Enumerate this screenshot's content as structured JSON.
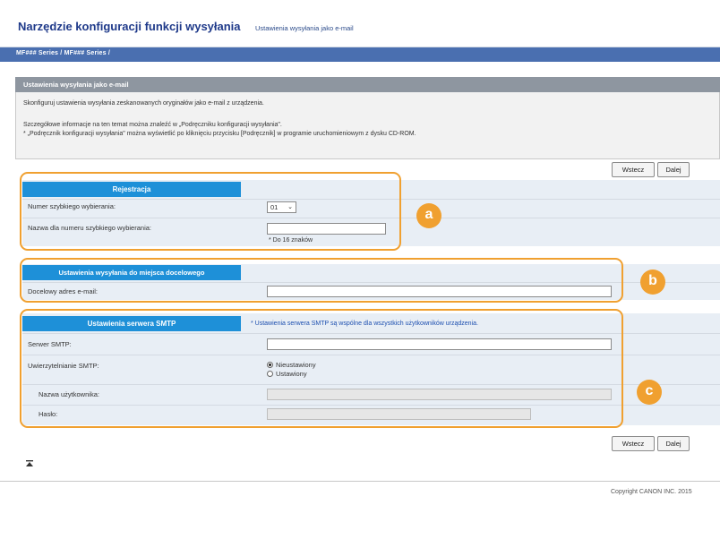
{
  "header": {
    "app_title": "Narzędzie konfiguracji funkcji wysyłania",
    "page_subtitle": "Ustawienia wysyłania jako e-mail"
  },
  "breadcrumb": "MF### Series / MF### Series /",
  "info": {
    "title": "Ustawienia wysyłania jako e-mail",
    "line1": "Skonfiguruj ustawienia wysyłania zeskanowanych oryginałów jako e-mail z urządzenia.",
    "line2": "Szczegółowe informacje na ten temat można znaleźć w „Podręczniku konfiguracji wysyłania\".",
    "line3": "* „Podręcznik konfiguracji wysyłania\" można wyświetlić po kliknięciu przycisku [Podręcznik] w programie uruchomieniowym z dysku CD-ROM."
  },
  "nav_buttons": {
    "back": "Wstecz",
    "next": "Dalej"
  },
  "registration": {
    "header": "Rejestracja",
    "speed_dial_label": "Numer szybkiego wybierania:",
    "speed_dial_value": "01",
    "name_label": "Nazwa dla numeru szybkiego wybierania:",
    "name_value": "",
    "name_hint": "* Do 16 znaków"
  },
  "destination": {
    "header": "Ustawienia wysyłania do miejsca docelowego",
    "email_label": "Docelowy adres e-mail:",
    "email_value": ""
  },
  "smtp": {
    "header": "Ustawienia serwera SMTP",
    "note": "* Ustawienia serwera SMTP są wspólne dla wszystkich użytkowników urządzenia.",
    "server_label": "Serwer SMTP:",
    "server_value": "",
    "auth_label": "Uwierzytelnianie SMTP:",
    "auth_options": [
      "Nieustawiony",
      "Ustawiony"
    ],
    "auth_selected": "Nieustawiony",
    "username_label": "Nazwa użytkownika:",
    "password_label": "Hasło:"
  },
  "callouts": {
    "a": "a",
    "b": "b",
    "c": "c"
  },
  "footer": {
    "top_link_icon": "page-top-icon",
    "copyright": "Copyright CANON INC. 2015"
  },
  "colors": {
    "accent": "#1e90d8",
    "callout": "#f0a030",
    "title": "#1f3a8a"
  }
}
